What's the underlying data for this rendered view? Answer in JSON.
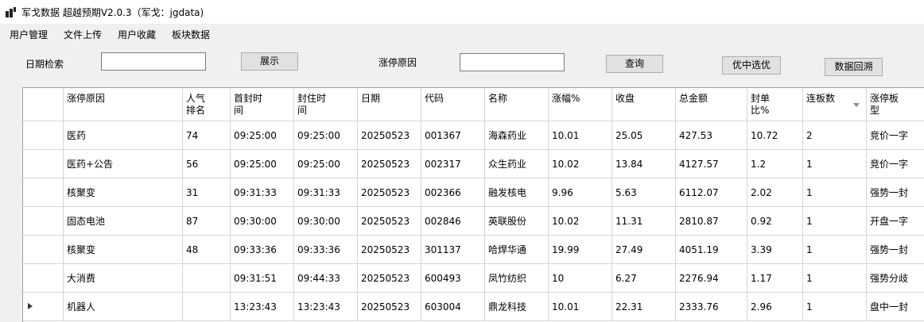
{
  "window": {
    "title": "军戈数据 超越预期V2.0.3（军戈：jgdata)"
  },
  "menu": [
    "用户管理",
    "文件上传",
    "用户收藏",
    "板块数据"
  ],
  "search": {
    "date_label": "日期检索",
    "date_value": "",
    "show_button": "展示",
    "reason_label": "涨停原因",
    "reason_value": "",
    "query_button": "查询",
    "select_button": "优中选优",
    "backtrack_button": "数据回溯"
  },
  "table": {
    "columns": [
      "涨停原因",
      "人气排名",
      "首封时间",
      "封住时间",
      "日期",
      "代码",
      "名称",
      "涨幅%",
      "收盘",
      "总金额",
      "封单比%",
      "连板数",
      "涨停板型"
    ],
    "columns_display": [
      "涨停原因",
      "人气\n排名",
      "首封时\n间",
      "封住时\n间",
      "日期",
      "代码",
      "名称",
      "涨幅%",
      "收盘",
      "总金额",
      "封单\n比%",
      "连板数",
      "涨停板\n型"
    ],
    "rows": [
      [
        "医药",
        "74",
        "09:25:00",
        "09:25:00",
        "20250523",
        "001367",
        "海森药业",
        "10.01",
        "25.05",
        "427.53",
        "10.72",
        "2",
        "竞价一字"
      ],
      [
        "医药+公告",
        "56",
        "09:25:00",
        "09:25:00",
        "20250523",
        "002317",
        "众生药业",
        "10.02",
        "13.84",
        "4127.57",
        "1.2",
        "1",
        "竞价一字"
      ],
      [
        "核聚变",
        "31",
        "09:31:33",
        "09:31:33",
        "20250523",
        "002366",
        "融发核电",
        "9.96",
        "5.63",
        "6112.07",
        "2.02",
        "1",
        "强势一封"
      ],
      [
        "固态电池",
        "87",
        "09:30:00",
        "09:30:00",
        "20250523",
        "002846",
        "英联股份",
        "10.02",
        "11.31",
        "2810.87",
        "0.92",
        "1",
        "开盘一字"
      ],
      [
        "核聚变",
        "48",
        "09:33:36",
        "09:33:36",
        "20250523",
        "301137",
        "哈焊华通",
        "19.99",
        "27.49",
        "4051.19",
        "3.39",
        "1",
        "强势一封"
      ],
      [
        "大消费",
        "",
        "09:31:51",
        "09:44:33",
        "20250523",
        "600493",
        "凤竹纺织",
        "10",
        "6.27",
        "2276.94",
        "1.17",
        "1",
        "强势分歧"
      ],
      [
        "机器人",
        "",
        "13:23:43",
        "13:23:43",
        "20250523",
        "603004",
        "鼎龙科技",
        "10.01",
        "22.31",
        "2333.76",
        "2.96",
        "1",
        "盘中一封"
      ]
    ],
    "current_row": 6,
    "sorted_column": 11
  }
}
